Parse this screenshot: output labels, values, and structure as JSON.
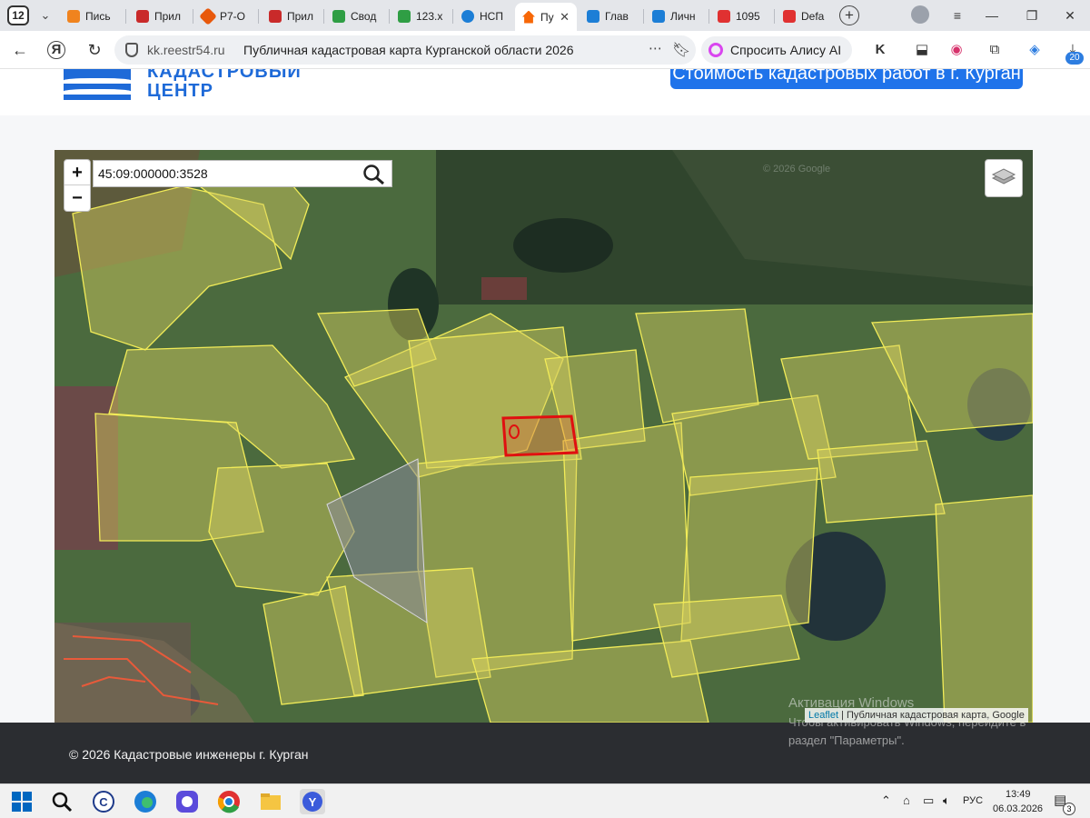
{
  "browser": {
    "tab_count": "12",
    "tabs": [
      {
        "label": "Пись",
        "color": "#f0831e"
      },
      {
        "label": "Прил",
        "color": "#c92a2a"
      },
      {
        "label": "Р7-О",
        "color": "#e8590c"
      },
      {
        "label": "Прил",
        "color": "#c92a2a"
      },
      {
        "label": "Свод",
        "color": "#2f9e44"
      },
      {
        "label": "123.x",
        "color": "#2f9e44"
      },
      {
        "label": "НСП",
        "color": "#1c7ed6"
      },
      {
        "label": "Пу",
        "color": "#f76707"
      },
      {
        "label": "Глав",
        "color": "#1c7ed6"
      },
      {
        "label": "Личн",
        "color": "#1c7ed6"
      },
      {
        "label": "1095",
        "color": "#e03131"
      },
      {
        "label": "Defa",
        "color": "#e03131"
      }
    ],
    "active_tab_close": "✕",
    "domain": "kk.reestr54.ru",
    "page_title": "Публичная кадастровая карта Курганской области 2026",
    "alice_label": "Спросить Алису AI",
    "extension_badge": "20"
  },
  "site": {
    "logo_line1": "КАДАСТРОВЫЙ",
    "logo_line2": "ЦЕНТР",
    "cta_label": "Стоимость кадастровых работ в г. Курган"
  },
  "map": {
    "zoom_in": "+",
    "zoom_out": "−",
    "search_value": "45:09:000000:3528",
    "google_watermark": "© 2026 Google",
    "attribution_link": "Leaflet",
    "attribution_text": " | Публичная кадастровая карта, Google",
    "colors": {
      "parcel_fill": "#d8d060",
      "parcel_stroke": "#f2ec58",
      "selected_stroke": "#e01010"
    }
  },
  "footer": {
    "copyright": "© 2026 Кадастровые инженеры г. Курган"
  },
  "windows_watermark": {
    "line1": "Активация Windows",
    "line2": "Чтобы активировать Windows, перейдите в",
    "line3": "раздел \"Параметры\"."
  },
  "taskbar": {
    "language": "РУС",
    "time": "13:49",
    "date": "06.03.2026",
    "notifications": "3"
  }
}
